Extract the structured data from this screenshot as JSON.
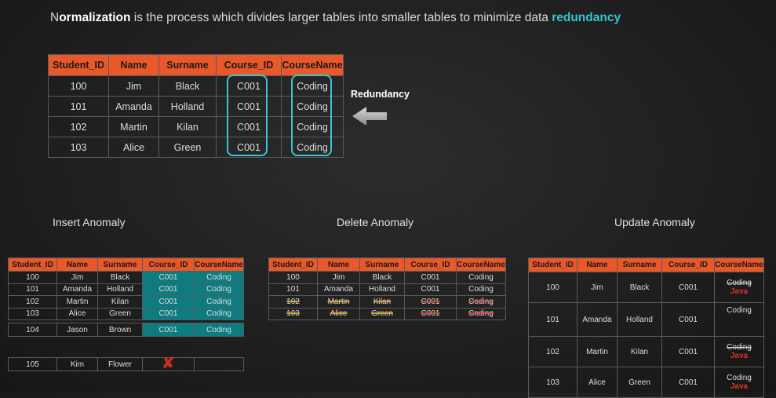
{
  "headline": {
    "lead": "N",
    "bold": "ormalization",
    "rest": " is the process which divides larger tables into smaller tables to minimize data ",
    "accent": "redundancy"
  },
  "main_table": {
    "headers": [
      "Student_ID",
      "Name",
      "Surname",
      "Course_ID",
      "CourseName"
    ],
    "rows": [
      [
        "100",
        "Jim",
        "Black",
        "C001",
        "Coding"
      ],
      [
        "101",
        "Amanda",
        "Holland",
        "C001",
        "Coding"
      ],
      [
        "102",
        "Martin",
        "Kilan",
        "C001",
        "Coding"
      ],
      [
        "103",
        "Alice",
        "Green",
        "C001",
        "Coding"
      ]
    ]
  },
  "redundancy_label": "Redundancy",
  "insert": {
    "title": "Insert Anomaly",
    "headers": [
      "Student_ID",
      "Name",
      "Surname",
      "Course_ID",
      "CourseName"
    ],
    "rows": [
      [
        "100",
        "Jim",
        "Black",
        "C001",
        "Coding"
      ],
      [
        "101",
        "Amanda",
        "Holland",
        "C001",
        "Coding"
      ],
      [
        "102",
        "Martin",
        "Kilan",
        "C001",
        "Coding"
      ],
      [
        "103",
        "Alice",
        "Green",
        "C001",
        "Coding"
      ]
    ],
    "new_row": [
      "104",
      "Jason",
      "Brown",
      "C001",
      "Coding"
    ],
    "failed_row": [
      "105",
      "Kim",
      "Flower",
      "✘",
      ""
    ]
  },
  "delete": {
    "title": "Delete Anomaly",
    "headers": [
      "Student_ID",
      "Name",
      "Surname",
      "Course_ID",
      "CourseName"
    ],
    "rows": [
      [
        "100",
        "Jim",
        "Black",
        "C001",
        "Coding"
      ],
      [
        "101",
        "Amanda",
        "Holland",
        "C001",
        "Coding"
      ],
      [
        "102",
        "Martin",
        "Kilan",
        "C001",
        "Coding"
      ],
      [
        "103",
        "Alice",
        "Green",
        "C001",
        "Coding"
      ]
    ]
  },
  "update": {
    "title": "Update Anomaly",
    "headers": [
      "Student_ID",
      "Name",
      "Surname",
      "Course_ID",
      "CourseName"
    ],
    "rows": [
      [
        "100",
        "Jim",
        "Black",
        "C001",
        "Coding",
        "Java"
      ],
      [
        "101",
        "Amanda",
        "Holland",
        "C001",
        "Coding",
        ""
      ],
      [
        "102",
        "Martin",
        "Kilan",
        "C001",
        "Coding",
        "Java"
      ],
      [
        "103",
        "Alice",
        "Green",
        "C001",
        "Coding",
        "Java"
      ]
    ]
  },
  "colors": {
    "header_orange": "#e8582a",
    "highlight_teal": "#0d7c80",
    "accent_cyan": "#34c6d0",
    "strike_orange": "#d9a12c",
    "strike_red": "#d84a3c",
    "new_value_red": "#d8332a"
  }
}
